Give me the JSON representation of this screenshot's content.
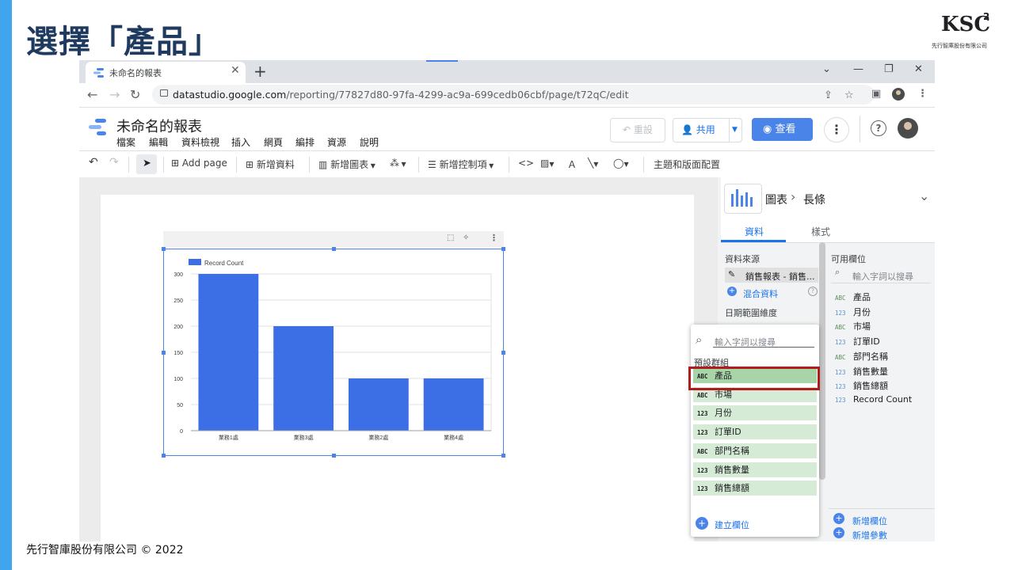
{
  "slide": {
    "title": "選擇「產品」",
    "footer": "先行智庫股份有限公司 © 2022",
    "logo_text": "KSC",
    "logo_sup": "2",
    "logo_sub": "先行智庫股份有限公司"
  },
  "browser": {
    "tab_title": "未命名的報表",
    "tab_close": "✕",
    "new_tab": "+",
    "url_domain": "datastudio.google.com",
    "url_path": "/reporting/77827d80-97fa-4299-ac9a-699cedb06cbf/page/t72qC/edit"
  },
  "app": {
    "report_title": "未命名的報表",
    "menu": [
      "檔案",
      "編輯",
      "資料檢視",
      "插入",
      "網頁",
      "編排",
      "資源",
      "說明"
    ],
    "reset_label": "重設",
    "share_label": "共用",
    "view_label": "查看"
  },
  "toolbar": {
    "add_page": "Add page",
    "add_data": "新增資料",
    "add_chart": "新增圖表",
    "add_control": "新增控制項",
    "theme_layout": "主題和版面配置"
  },
  "panel": {
    "breadcrumb_chart": "圖表",
    "breadcrumb_sep": "›",
    "breadcrumb_type": "長條",
    "tab_data": "資料",
    "tab_style": "樣式",
    "data_source_label": "資料來源",
    "data_source_name": "銷售報表 - 銷售...",
    "blend_data": "混合資料",
    "date_range_label": "日期範圍維度",
    "available_fields_label": "可用欄位",
    "search_placeholder": "輸入字詞以搜尋",
    "available_fields": [
      {
        "type": "ABC",
        "name": "產品"
      },
      {
        "type": "123",
        "name": "月份"
      },
      {
        "type": "ABC",
        "name": "市場"
      },
      {
        "type": "123",
        "name": "訂單ID"
      },
      {
        "type": "ABC",
        "name": "部門名稱"
      },
      {
        "type": "123",
        "name": "銷售數量"
      },
      {
        "type": "123",
        "name": "銷售總額"
      },
      {
        "type": "123",
        "name": "Record Count"
      }
    ],
    "add_field": "新增欄位",
    "add_parameter": "新增參數"
  },
  "dropdown": {
    "search_placeholder": "輸入字詞以搜尋",
    "group_label": "預設群組",
    "items": [
      {
        "type": "ABC",
        "name": "產品"
      },
      {
        "type": "ABC",
        "name": "市場"
      },
      {
        "type": "123",
        "name": "月份"
      },
      {
        "type": "123",
        "name": "訂單ID"
      },
      {
        "type": "ABC",
        "name": "部門名稱"
      },
      {
        "type": "123",
        "name": "銷售數量"
      },
      {
        "type": "123",
        "name": "銷售總額"
      }
    ],
    "create_field": "建立欄位"
  },
  "colors": {
    "bar": "#3c6ee6",
    "accent": "#1a73e8",
    "highlight_border": "#b01c1c",
    "dropdown_item_bg": "#d5ebd5"
  },
  "chart_data": {
    "type": "bar",
    "categories": [
      "業務1處",
      "業務3處",
      "業務2處",
      "業務4處"
    ],
    "series": [
      {
        "name": "Record Count",
        "values": [
          300,
          200,
          100,
          100
        ]
      }
    ],
    "yticks": [
      "0",
      "50",
      "100",
      "150",
      "200",
      "250",
      "300"
    ],
    "ylim": [
      0,
      300
    ],
    "legend": "top-left",
    "grid": true
  }
}
